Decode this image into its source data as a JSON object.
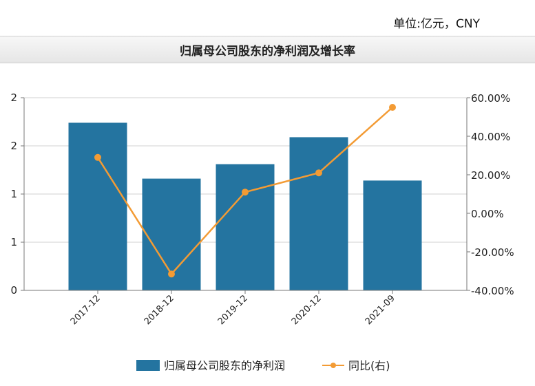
{
  "header": {
    "unit": "单位:亿元，CNY",
    "title": "归属母公司股东的净利润及增长率"
  },
  "colors": {
    "bar": "#2474a0",
    "line": "#f39b34",
    "grid": "#d0d0d0",
    "axis": "#777777"
  },
  "chart_data": {
    "type": "bar",
    "title": "归属母公司股东的净利润及增长率",
    "categories": [
      "2017-12",
      "2018-12",
      "2019-12",
      "2020-12",
      "2021-09"
    ],
    "series": [
      {
        "name": "归属母公司股东的净利润",
        "type": "bar",
        "axis": "left",
        "values": [
          1.74,
          1.16,
          1.31,
          1.59,
          1.14
        ]
      },
      {
        "name": "同比(右)",
        "type": "line",
        "axis": "right",
        "values": [
          29.0,
          -31.5,
          11.0,
          21.0,
          55.0
        ]
      }
    ],
    "left_axis": {
      "ylim": [
        0,
        2
      ],
      "ticks": [
        0,
        0.5,
        1,
        1.5,
        2
      ],
      "tick_labels": [
        "0",
        "1",
        "1",
        "2",
        "2"
      ]
    },
    "right_axis": {
      "ylim": [
        -40,
        60
      ],
      "ticks": [
        -40,
        -20,
        0,
        20,
        40,
        60
      ],
      "tick_labels": [
        "-40.00%",
        "-20.00%",
        "0.00%",
        "20.00%",
        "40.00%",
        "60.00%"
      ]
    },
    "grid": true,
    "legend_position": "bottom-center"
  }
}
